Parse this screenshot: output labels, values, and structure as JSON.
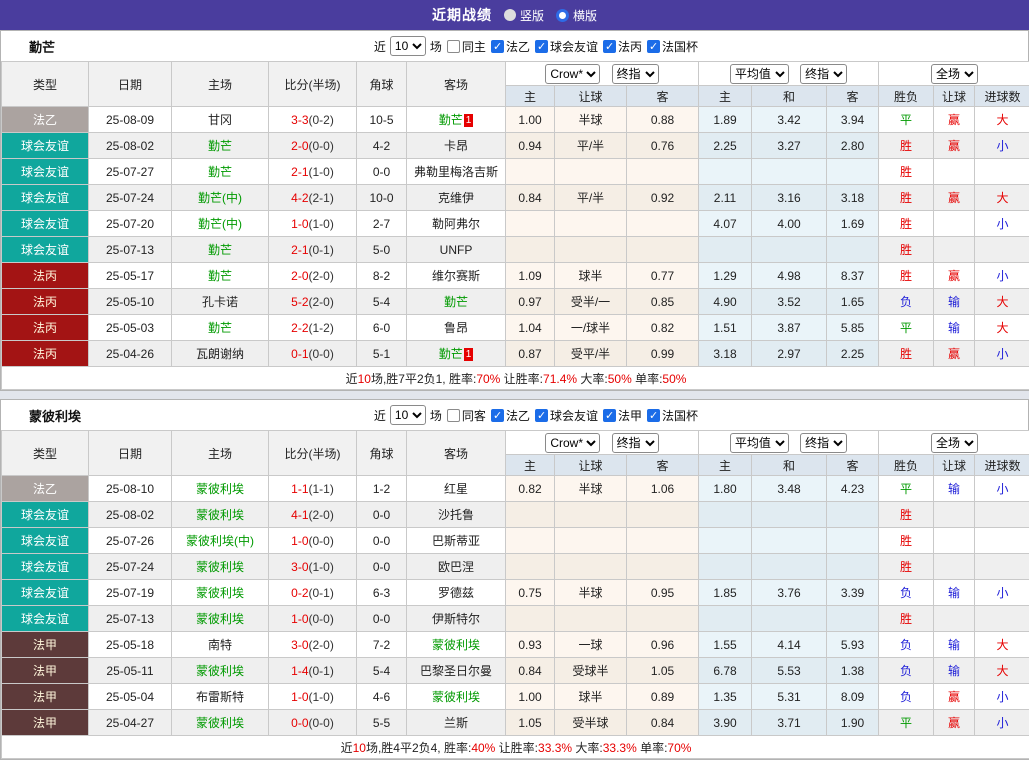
{
  "colors": {
    "top_bar_purple": "#4a3d9e",
    "type_ligue2_gray": "#aba3a0",
    "type_friendly_teal": "#10a79d",
    "type_fr3_red": "#a31414",
    "type_ligue1_maroon": "#5d3a3a",
    "win_red": "#e60000",
    "draw_green": "#009a00",
    "lose_blue": "#1d1dd8",
    "avg_col_blue": "#eaf4f9",
    "crow_col_cream": "#fdf6ef"
  },
  "top_bar": {
    "title": "近期战绩",
    "options": [
      {
        "label": "竖版",
        "selected": false
      },
      {
        "label": "横版",
        "selected": true
      }
    ]
  },
  "table_header": {
    "type": "类型",
    "date": "日期",
    "home": "主场",
    "score": "比分(半场)",
    "corner": "角球",
    "away": "客场",
    "odds_sub": {
      "home": "主",
      "handicap": "让球",
      "away": "客",
      "avg_home": "主",
      "draw": "和",
      "avg_away": "客"
    },
    "result_sub": {
      "result": "胜负",
      "handicap": "让球",
      "goals": "进球数"
    },
    "dropdowns": {
      "bookmaker": "Crow*",
      "final_a": "终指",
      "average": "平均值",
      "final_b": "终指",
      "full_match": "全场"
    }
  },
  "sections": [
    {
      "team": "勤芒",
      "filter": {
        "prefix": "近",
        "count": "10",
        "suffix": "场",
        "same": {
          "label": "同主",
          "checked": false
        },
        "leagues": [
          {
            "label": "法乙",
            "checked": true
          },
          {
            "label": "球会友谊",
            "checked": true
          },
          {
            "label": "法丙",
            "checked": true
          },
          {
            "label": "法国杯",
            "checked": true
          }
        ]
      },
      "rows": [
        {
          "type": "法乙",
          "type_key": "ligue2",
          "date": "25-08-09",
          "home": {
            "name": "甘冈",
            "green": false
          },
          "score": "3-3",
          "half": "(0-2)",
          "corner": "10-5",
          "away": {
            "name": "勤芒",
            "green": true,
            "badge": "1"
          },
          "odds": [
            "1.00",
            "半球",
            "0.88"
          ],
          "avg": [
            "1.89",
            "3.42",
            "3.94"
          ],
          "outcome": [
            {
              "t": "平",
              "c": "green"
            },
            {
              "t": "赢",
              "c": "red"
            },
            {
              "t": "大",
              "c": "red"
            }
          ]
        },
        {
          "type": "球会友谊",
          "type_key": "friendly",
          "date": "25-08-02",
          "home": {
            "name": "勤芒",
            "green": true
          },
          "score": "2-0",
          "half": "(0-0)",
          "corner": "4-2",
          "away": {
            "name": "卡昂",
            "green": false
          },
          "odds": [
            "0.94",
            "平/半",
            "0.76"
          ],
          "avg": [
            "2.25",
            "3.27",
            "2.80"
          ],
          "outcome": [
            {
              "t": "胜",
              "c": "red"
            },
            {
              "t": "赢",
              "c": "red"
            },
            {
              "t": "小",
              "c": "blue"
            }
          ]
        },
        {
          "type": "球会友谊",
          "type_key": "friendly",
          "date": "25-07-27",
          "home": {
            "name": "勤芒",
            "green": true
          },
          "score": "2-1",
          "half": "(1-0)",
          "corner": "0-0",
          "away": {
            "name": "弗勒里梅洛吉斯",
            "green": false
          },
          "odds": [
            "",
            "",
            ""
          ],
          "avg": [
            "",
            "",
            ""
          ],
          "outcome": [
            {
              "t": "胜",
              "c": "red"
            },
            {
              "t": "",
              "c": ""
            },
            {
              "t": "",
              "c": ""
            }
          ]
        },
        {
          "type": "球会友谊",
          "type_key": "friendly",
          "date": "25-07-24",
          "home": {
            "name": "勤芒(中)",
            "green": true
          },
          "score": "4-2",
          "half": "(2-1)",
          "corner": "10-0",
          "away": {
            "name": "克维伊",
            "green": false
          },
          "odds": [
            "0.84",
            "平/半",
            "0.92"
          ],
          "avg": [
            "2.11",
            "3.16",
            "3.18"
          ],
          "outcome": [
            {
              "t": "胜",
              "c": "red"
            },
            {
              "t": "赢",
              "c": "red"
            },
            {
              "t": "大",
              "c": "red"
            }
          ]
        },
        {
          "type": "球会友谊",
          "type_key": "friendly",
          "date": "25-07-20",
          "home": {
            "name": "勤芒(中)",
            "green": true
          },
          "score": "1-0",
          "half": "(1-0)",
          "corner": "2-7",
          "away": {
            "name": "勒阿弗尔",
            "green": false
          },
          "odds": [
            "",
            "",
            ""
          ],
          "avg": [
            "4.07",
            "4.00",
            "1.69"
          ],
          "outcome": [
            {
              "t": "胜",
              "c": "red"
            },
            {
              "t": "",
              "c": ""
            },
            {
              "t": "小",
              "c": "blue"
            }
          ]
        },
        {
          "type": "球会友谊",
          "type_key": "friendly",
          "date": "25-07-13",
          "home": {
            "name": "勤芒",
            "green": true
          },
          "score": "2-1",
          "half": "(0-1)",
          "corner": "5-0",
          "away": {
            "name": "UNFP",
            "green": false
          },
          "odds": [
            "",
            "",
            ""
          ],
          "avg": [
            "",
            "",
            ""
          ],
          "outcome": [
            {
              "t": "胜",
              "c": "red"
            },
            {
              "t": "",
              "c": ""
            },
            {
              "t": "",
              "c": ""
            }
          ]
        },
        {
          "type": "法丙",
          "type_key": "fr3",
          "date": "25-05-17",
          "home": {
            "name": "勤芒",
            "green": true
          },
          "score": "2-0",
          "half": "(2-0)",
          "corner": "8-2",
          "away": {
            "name": "维尔赛斯",
            "green": false
          },
          "odds": [
            "1.09",
            "球半",
            "0.77"
          ],
          "avg": [
            "1.29",
            "4.98",
            "8.37"
          ],
          "outcome": [
            {
              "t": "胜",
              "c": "red"
            },
            {
              "t": "赢",
              "c": "red"
            },
            {
              "t": "小",
              "c": "blue"
            }
          ]
        },
        {
          "type": "法丙",
          "type_key": "fr3",
          "date": "25-05-10",
          "home": {
            "name": "孔卡诺",
            "green": false
          },
          "score": "5-2",
          "half": "(2-0)",
          "corner": "5-4",
          "away": {
            "name": "勤芒",
            "green": true
          },
          "odds": [
            "0.97",
            "受半/一",
            "0.85"
          ],
          "avg": [
            "4.90",
            "3.52",
            "1.65"
          ],
          "outcome": [
            {
              "t": "负",
              "c": "blue"
            },
            {
              "t": "输",
              "c": "blue"
            },
            {
              "t": "大",
              "c": "red"
            }
          ]
        },
        {
          "type": "法丙",
          "type_key": "fr3",
          "date": "25-05-03",
          "home": {
            "name": "勤芒",
            "green": true
          },
          "score": "2-2",
          "half": "(1-2)",
          "corner": "6-0",
          "away": {
            "name": "鲁昂",
            "green": false
          },
          "odds": [
            "1.04",
            "一/球半",
            "0.82"
          ],
          "avg": [
            "1.51",
            "3.87",
            "5.85"
          ],
          "outcome": [
            {
              "t": "平",
              "c": "green"
            },
            {
              "t": "输",
              "c": "blue"
            },
            {
              "t": "大",
              "c": "red"
            }
          ]
        },
        {
          "type": "法丙",
          "type_key": "fr3",
          "date": "25-04-26",
          "home": {
            "name": "瓦朗谢纳",
            "green": false
          },
          "score": "0-1",
          "half": "(0-0)",
          "corner": "5-1",
          "away": {
            "name": "勤芒",
            "green": true,
            "badge": "1"
          },
          "odds": [
            "0.87",
            "受平/半",
            "0.99"
          ],
          "avg": [
            "3.18",
            "2.97",
            "2.25"
          ],
          "outcome": [
            {
              "t": "胜",
              "c": "red"
            },
            {
              "t": "赢",
              "c": "red"
            },
            {
              "t": "小",
              "c": "blue"
            }
          ]
        }
      ],
      "summary": [
        {
          "t": "近"
        },
        {
          "t": "10",
          "red": true
        },
        {
          "t": "场,胜7平2负1, 胜率:"
        },
        {
          "t": "70%",
          "red": true
        },
        {
          "t": " 让胜率:"
        },
        {
          "t": "71.4%",
          "red": true
        },
        {
          "t": " 大率:"
        },
        {
          "t": "50%",
          "red": true
        },
        {
          "t": " 单率:"
        },
        {
          "t": "50%",
          "red": true
        }
      ]
    },
    {
      "team": "蒙彼利埃",
      "filter": {
        "prefix": "近",
        "count": "10",
        "suffix": "场",
        "same": {
          "label": "同客",
          "checked": false
        },
        "leagues": [
          {
            "label": "法乙",
            "checked": true
          },
          {
            "label": "球会友谊",
            "checked": true
          },
          {
            "label": "法甲",
            "checked": true
          },
          {
            "label": "法国杯",
            "checked": true
          }
        ]
      },
      "rows": [
        {
          "type": "法乙",
          "type_key": "ligue2",
          "date": "25-08-10",
          "home": {
            "name": "蒙彼利埃",
            "green": true
          },
          "score": "1-1",
          "half": "(1-1)",
          "corner": "1-2",
          "away": {
            "name": "红星",
            "green": false
          },
          "odds": [
            "0.82",
            "半球",
            "1.06"
          ],
          "avg": [
            "1.80",
            "3.48",
            "4.23"
          ],
          "outcome": [
            {
              "t": "平",
              "c": "green"
            },
            {
              "t": "输",
              "c": "blue"
            },
            {
              "t": "小",
              "c": "blue"
            }
          ]
        },
        {
          "type": "球会友谊",
          "type_key": "friendly",
          "date": "25-08-02",
          "home": {
            "name": "蒙彼利埃",
            "green": true
          },
          "score": "4-1",
          "half": "(2-0)",
          "corner": "0-0",
          "away": {
            "name": "沙托鲁",
            "green": false
          },
          "odds": [
            "",
            "",
            ""
          ],
          "avg": [
            "",
            "",
            ""
          ],
          "outcome": [
            {
              "t": "胜",
              "c": "red"
            },
            {
              "t": "",
              "c": ""
            },
            {
              "t": "",
              "c": ""
            }
          ]
        },
        {
          "type": "球会友谊",
          "type_key": "friendly",
          "date": "25-07-26",
          "home": {
            "name": "蒙彼利埃(中)",
            "green": true
          },
          "score": "1-0",
          "half": "(0-0)",
          "corner": "0-0",
          "away": {
            "name": "巴斯蒂亚",
            "green": false
          },
          "odds": [
            "",
            "",
            ""
          ],
          "avg": [
            "",
            "",
            ""
          ],
          "outcome": [
            {
              "t": "胜",
              "c": "red"
            },
            {
              "t": "",
              "c": ""
            },
            {
              "t": "",
              "c": ""
            }
          ]
        },
        {
          "type": "球会友谊",
          "type_key": "friendly",
          "date": "25-07-24",
          "home": {
            "name": "蒙彼利埃",
            "green": true
          },
          "score": "3-0",
          "half": "(1-0)",
          "corner": "0-0",
          "away": {
            "name": "欧巴涅",
            "green": false
          },
          "odds": [
            "",
            "",
            ""
          ],
          "avg": [
            "",
            "",
            ""
          ],
          "outcome": [
            {
              "t": "胜",
              "c": "red"
            },
            {
              "t": "",
              "c": ""
            },
            {
              "t": "",
              "c": ""
            }
          ]
        },
        {
          "type": "球会友谊",
          "type_key": "friendly",
          "date": "25-07-19",
          "home": {
            "name": "蒙彼利埃",
            "green": true
          },
          "score": "0-2",
          "half": "(0-1)",
          "corner": "6-3",
          "away": {
            "name": "罗德兹",
            "green": false
          },
          "odds": [
            "0.75",
            "半球",
            "0.95"
          ],
          "avg": [
            "1.85",
            "3.76",
            "3.39"
          ],
          "outcome": [
            {
              "t": "负",
              "c": "blue"
            },
            {
              "t": "输",
              "c": "blue"
            },
            {
              "t": "小",
              "c": "blue"
            }
          ]
        },
        {
          "type": "球会友谊",
          "type_key": "friendly",
          "date": "25-07-13",
          "home": {
            "name": "蒙彼利埃",
            "green": true
          },
          "score": "1-0",
          "half": "(0-0)",
          "corner": "0-0",
          "away": {
            "name": "伊斯特尔",
            "green": false
          },
          "odds": [
            "",
            "",
            ""
          ],
          "avg": [
            "",
            "",
            ""
          ],
          "outcome": [
            {
              "t": "胜",
              "c": "red"
            },
            {
              "t": "",
              "c": ""
            },
            {
              "t": "",
              "c": ""
            }
          ]
        },
        {
          "type": "法甲",
          "type_key": "ligue1",
          "date": "25-05-18",
          "home": {
            "name": "南特",
            "green": false
          },
          "score": "3-0",
          "half": "(2-0)",
          "corner": "7-2",
          "away": {
            "name": "蒙彼利埃",
            "green": true
          },
          "odds": [
            "0.93",
            "一球",
            "0.96"
          ],
          "avg": [
            "1.55",
            "4.14",
            "5.93"
          ],
          "outcome": [
            {
              "t": "负",
              "c": "blue"
            },
            {
              "t": "输",
              "c": "blue"
            },
            {
              "t": "大",
              "c": "red"
            }
          ]
        },
        {
          "type": "法甲",
          "type_key": "ligue1",
          "date": "25-05-11",
          "home": {
            "name": "蒙彼利埃",
            "green": true
          },
          "score": "1-4",
          "half": "(0-1)",
          "corner": "5-4",
          "away": {
            "name": "巴黎圣日尔曼",
            "green": false
          },
          "odds": [
            "0.84",
            "受球半",
            "1.05"
          ],
          "avg": [
            "6.78",
            "5.53",
            "1.38"
          ],
          "outcome": [
            {
              "t": "负",
              "c": "blue"
            },
            {
              "t": "输",
              "c": "blue"
            },
            {
              "t": "大",
              "c": "red"
            }
          ]
        },
        {
          "type": "法甲",
          "type_key": "ligue1",
          "date": "25-05-04",
          "home": {
            "name": "布雷斯特",
            "green": false
          },
          "score": "1-0",
          "half": "(1-0)",
          "corner": "4-6",
          "away": {
            "name": "蒙彼利埃",
            "green": true
          },
          "odds": [
            "1.00",
            "球半",
            "0.89"
          ],
          "avg": [
            "1.35",
            "5.31",
            "8.09"
          ],
          "outcome": [
            {
              "t": "负",
              "c": "blue"
            },
            {
              "t": "赢",
              "c": "red"
            },
            {
              "t": "小",
              "c": "blue"
            }
          ]
        },
        {
          "type": "法甲",
          "type_key": "ligue1",
          "date": "25-04-27",
          "home": {
            "name": "蒙彼利埃",
            "green": true
          },
          "score": "0-0",
          "half": "(0-0)",
          "corner": "5-5",
          "away": {
            "name": "兰斯",
            "green": false
          },
          "odds": [
            "1.05",
            "受半球",
            "0.84"
          ],
          "avg": [
            "3.90",
            "3.71",
            "1.90"
          ],
          "outcome": [
            {
              "t": "平",
              "c": "green"
            },
            {
              "t": "赢",
              "c": "red"
            },
            {
              "t": "小",
              "c": "blue"
            }
          ]
        }
      ],
      "summary": [
        {
          "t": "近"
        },
        {
          "t": "10",
          "red": true
        },
        {
          "t": "场,胜4平2负4, 胜率:"
        },
        {
          "t": "40%",
          "red": true
        },
        {
          "t": " 让胜率:"
        },
        {
          "t": "33.3%",
          "red": true
        },
        {
          "t": " 大率:"
        },
        {
          "t": "33.3%",
          "red": true
        },
        {
          "t": " 单率:"
        },
        {
          "t": "70%",
          "red": true
        }
      ]
    }
  ]
}
